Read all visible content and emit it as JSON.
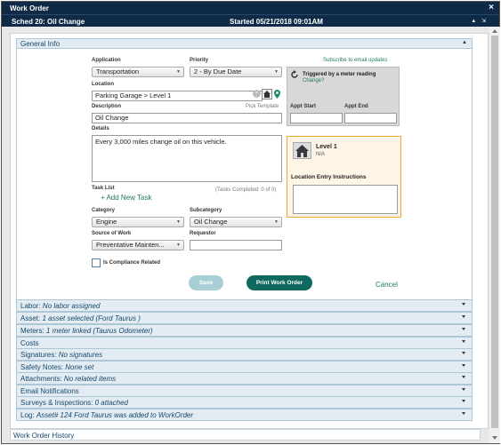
{
  "window": {
    "title": "Work Order",
    "close_glyph": "×",
    "sched": "Sched 20: Oil Change",
    "started": "Started 05/21/2018 09:01AM",
    "controls": "▲ ⇲"
  },
  "general": {
    "header": "General Info",
    "caret": "▲",
    "application_label": "Application",
    "application_value": "Transportation",
    "priority_label": "Priority",
    "priority_value": "2 - By Due Date",
    "subscribe_link": "Subscribe to email updates",
    "location_label": "Location",
    "location_value": "Parking Garage > Level 1",
    "description_label": "Description",
    "pick_template": "Pick Template",
    "description_value": "Oil Change",
    "details_label": "Details",
    "details_value": "Every 3,000 miles change oil on this vehicle.",
    "task_list_label": "Task List",
    "tasks_completed": "(Tasks Completed: 0 of 0)",
    "add_task": "+ Add New Task",
    "category_label": "Category",
    "category_value": "Engine",
    "subcategory_label": "Subcategory",
    "subcategory_value": "Oil Change",
    "source_label": "Source of Work",
    "source_value": "Preventative Mainten...",
    "requestor_label": "Requestor",
    "requestor_value": "",
    "compliance_label": "Is Compliance Related",
    "meter_trigger": "Triggered by a meter reading",
    "meter_change": "Change?",
    "appt_start_label": "Appt Start",
    "appt_end_label": "Appt End",
    "loc_name": "Level 1",
    "loc_sub": "N/A",
    "loc_instructions_label": "Location Entry Instructions",
    "save_label": "Save",
    "print_label": "Print Work Order",
    "cancel_label": "Cancel"
  },
  "sections": [
    {
      "label": "Labor:",
      "detail": "No labor assigned"
    },
    {
      "label": "Asset:",
      "detail": "1 asset selected (Ford Taurus )"
    },
    {
      "label": "Meters:",
      "detail": "1 meter linked (Taurus Odometer)"
    },
    {
      "label": "Costs",
      "detail": ""
    },
    {
      "label": "Signatures:",
      "detail": "No signatures"
    },
    {
      "label": "Safety Notes:",
      "detail": "None set"
    },
    {
      "label": "Attachments:",
      "detail": "No related items"
    },
    {
      "label": "Email Notifications",
      "detail": ""
    },
    {
      "label": "Surveys & Inspections:",
      "detail": "0 attached"
    },
    {
      "label": "Log:",
      "detail": "Asset# 124 Ford Taurus was added to WorkOrder"
    }
  ],
  "history_label": "Work Order History",
  "colors": {
    "titlebar": "#0e2a47",
    "accent": "#10695e",
    "section_bg": "#e2ecf2",
    "location_highlight": "#f0a63a"
  }
}
